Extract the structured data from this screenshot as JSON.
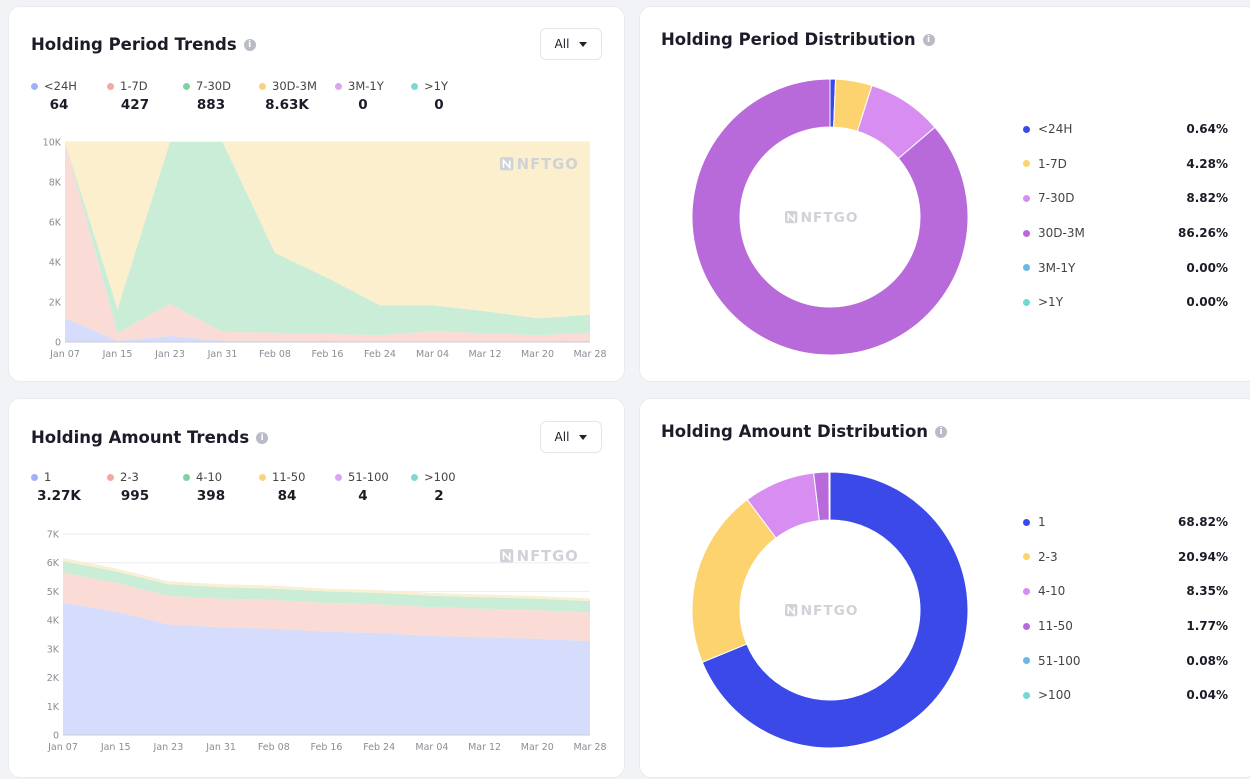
{
  "panel1": {
    "title": "Holding Period Trends",
    "dropdown": "All",
    "legend": [
      {
        "label": "<24H",
        "value": "64",
        "color": "#9fb2f5"
      },
      {
        "label": "1-7D",
        "value": "427",
        "color": "#f4a9a0"
      },
      {
        "label": "7-30D",
        "value": "883",
        "color": "#7fd1a0"
      },
      {
        "label": "30D-3M",
        "value": "8.63K",
        "color": "#f9d37f"
      },
      {
        "label": "3M-1Y",
        "value": "0",
        "color": "#d9a6f0"
      },
      {
        "label": ">1Y",
        "value": "0",
        "color": "#7fd9d2"
      }
    ],
    "watermark": "NFTGO",
    "chart_data": {
      "type": "area",
      "stacked": true,
      "x": [
        "Jan 07",
        "Jan 15",
        "Jan 23",
        "Jan 31",
        "Feb 08",
        "Feb 16",
        "Feb 24",
        "Mar 04",
        "Mar 12",
        "Mar 20",
        "Mar 28"
      ],
      "ylim": [
        0,
        10000
      ],
      "yticks": [
        "0",
        "2K",
        "4K",
        "6K",
        "8K",
        "10K"
      ],
      "grid": true,
      "series": [
        {
          "name": "<24H",
          "color": "#d6dcfb",
          "values": [
            1200,
            50,
            300,
            60,
            60,
            50,
            40,
            40,
            40,
            40,
            60
          ]
        },
        {
          "name": "1-7D",
          "color": "#fadbd5",
          "values": [
            8800,
            400,
            1600,
            450,
            400,
            350,
            300,
            500,
            400,
            300,
            400
          ]
        },
        {
          "name": "7-30D",
          "color": "#c9edd6",
          "values": [
            0,
            1200,
            8100,
            9490,
            4000,
            2800,
            1500,
            1300,
            1100,
            850,
            900
          ]
        },
        {
          "name": "30D-3M",
          "color": "#fbefcd",
          "values": [
            0,
            8350,
            0,
            0,
            5540,
            6800,
            8160,
            8160,
            8460,
            8810,
            8640
          ]
        },
        {
          "name": "3M-1Y",
          "color": "#eed9f7",
          "values": [
            0,
            0,
            0,
            0,
            0,
            0,
            0,
            0,
            0,
            0,
            0
          ]
        },
        {
          "name": ">1Y",
          "color": "#d4f1ef",
          "values": [
            0,
            0,
            0,
            0,
            0,
            0,
            0,
            0,
            0,
            0,
            0
          ]
        }
      ]
    }
  },
  "panel2": {
    "title": "Holding Period Distribution",
    "watermark": "NFTGO",
    "chart_data": {
      "type": "pie",
      "donut": true,
      "labels": [
        "<24H",
        "1-7D",
        "7-30D",
        "30D-3M",
        "3M-1Y",
        ">1Y"
      ],
      "values": [
        0.64,
        4.28,
        8.82,
        86.26,
        0.0,
        0.0
      ],
      "display": [
        "0.64%",
        "4.28%",
        "8.82%",
        "86.26%",
        "0.00%",
        "0.00%"
      ],
      "colors": [
        "#3a49e8",
        "#fdd36f",
        "#d78ef0",
        "#b96ada",
        "#6ab7e8",
        "#6fd9d2"
      ]
    }
  },
  "panel3": {
    "title": "Holding Amount Trends",
    "dropdown": "All",
    "legend": [
      {
        "label": "1",
        "value": "3.27K",
        "color": "#9fb2f5"
      },
      {
        "label": "2-3",
        "value": "995",
        "color": "#f4a9a0"
      },
      {
        "label": "4-10",
        "value": "398",
        "color": "#7fd1a0"
      },
      {
        "label": "11-50",
        "value": "84",
        "color": "#f9d37f"
      },
      {
        "label": "51-100",
        "value": "4",
        "color": "#d9a6f0"
      },
      {
        "label": ">100",
        "value": "2",
        "color": "#7fd9d2"
      }
    ],
    "watermark": "NFTGO",
    "chart_data": {
      "type": "area",
      "stacked": true,
      "x": [
        "Jan 07",
        "Jan 15",
        "Jan 23",
        "Jan 31",
        "Feb 08",
        "Feb 16",
        "Feb 24",
        "Mar 04",
        "Mar 12",
        "Mar 20",
        "Mar 28"
      ],
      "ylim": [
        0,
        7000
      ],
      "yticks": [
        "0",
        "1K",
        "2K",
        "3K",
        "4K",
        "5K",
        "6K",
        "7K"
      ],
      "grid": true,
      "series": [
        {
          "name": "1",
          "color": "#d6dcfb",
          "values": [
            4600,
            4300,
            3850,
            3750,
            3700,
            3600,
            3550,
            3450,
            3400,
            3350,
            3270
          ]
        },
        {
          "name": "2-3",
          "color": "#fadbd5",
          "values": [
            1050,
            1000,
            1000,
            1000,
            1000,
            1000,
            1000,
            1000,
            1000,
            1000,
            995
          ]
        },
        {
          "name": "4-10",
          "color": "#c9edd6",
          "values": [
            400,
            400,
            400,
            400,
            400,
            400,
            400,
            400,
            400,
            400,
            398
          ]
        },
        {
          "name": "11-50",
          "color": "#fbefcd",
          "values": [
            100,
            90,
            90,
            90,
            90,
            90,
            90,
            90,
            85,
            85,
            84
          ]
        },
        {
          "name": "51-100",
          "color": "#eed9f7",
          "values": [
            10,
            8,
            6,
            5,
            5,
            5,
            5,
            4,
            4,
            4,
            4
          ]
        },
        {
          "name": ">100",
          "color": "#d4f1ef",
          "values": [
            5,
            4,
            3,
            3,
            3,
            3,
            3,
            2,
            2,
            2,
            2
          ]
        }
      ]
    }
  },
  "panel4": {
    "title": "Holding Amount Distribution",
    "watermark": "NFTGO",
    "chart_data": {
      "type": "pie",
      "donut": true,
      "labels": [
        "1",
        "2-3",
        "4-10",
        "11-50",
        "51-100",
        ">100"
      ],
      "values": [
        68.82,
        20.94,
        8.35,
        1.77,
        0.08,
        0.04
      ],
      "display": [
        "68.82%",
        "20.94%",
        "8.35%",
        "1.77%",
        "0.08%",
        "0.04%"
      ],
      "colors": [
        "#3a49e8",
        "#fdd36f",
        "#d78ef0",
        "#b96ada",
        "#6ab7e8",
        "#6fd9d2"
      ]
    }
  }
}
